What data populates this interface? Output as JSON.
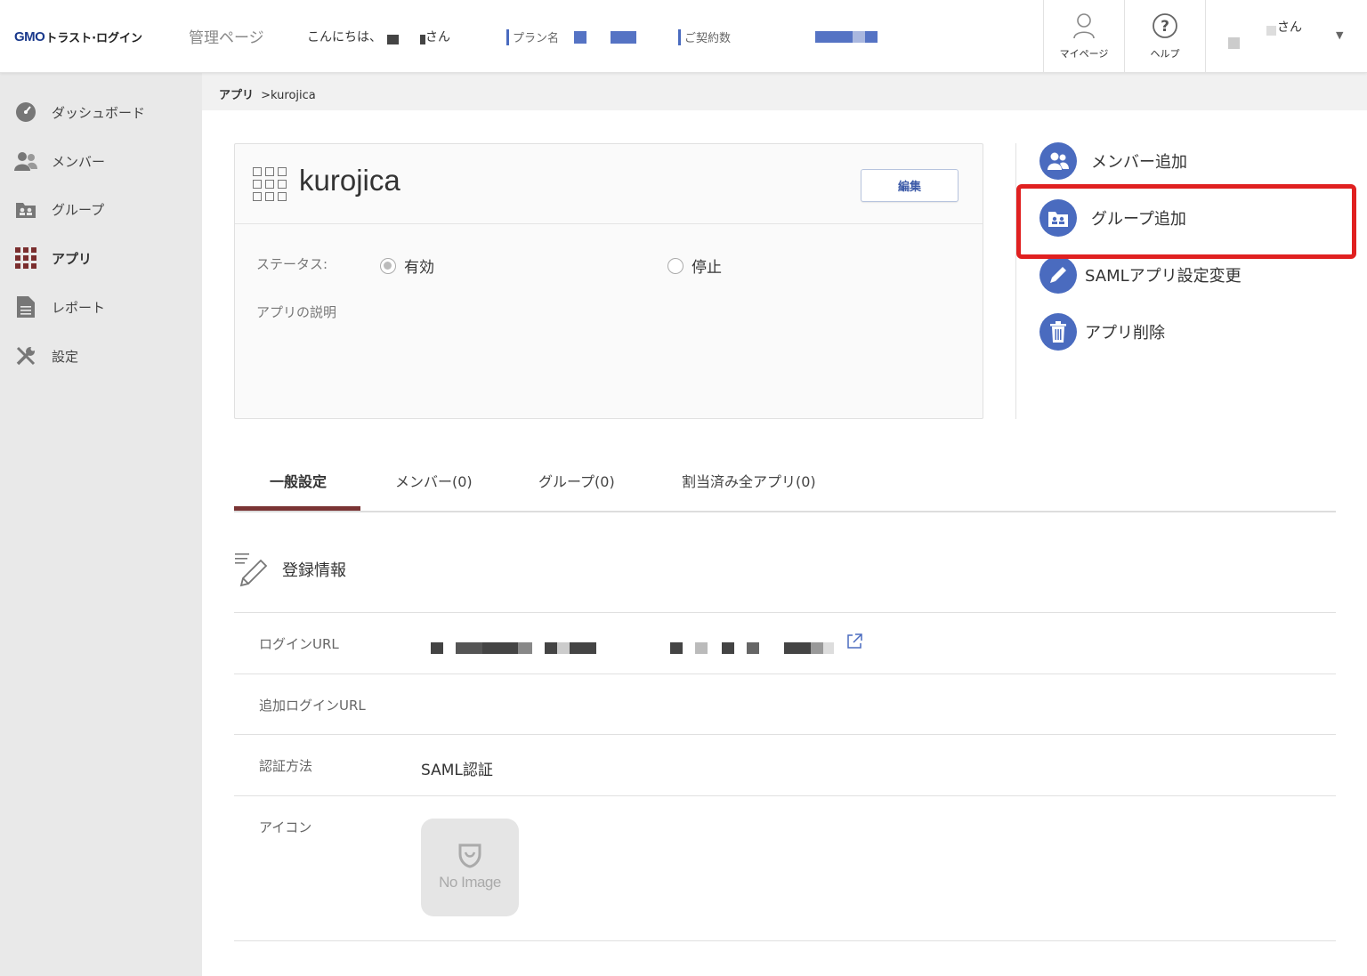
{
  "header": {
    "logo_brand": "GMO",
    "logo_text": "トラスト·ログイン",
    "admin_title": "管理ページ",
    "greeting_prefix": "こんにちは、",
    "greeting_suffix": "さん",
    "plan_label": "プラン名",
    "contract_label": "ご契約数",
    "mypage_label": "マイページ",
    "help_label": "ヘルプ",
    "user_suffix": "さん"
  },
  "sidebar": {
    "items": [
      {
        "label": "ダッシュボード",
        "icon": "dashboard-icon"
      },
      {
        "label": "メンバー",
        "icon": "members-icon"
      },
      {
        "label": "グループ",
        "icon": "group-icon"
      },
      {
        "label": "アプリ",
        "icon": "apps-grid-icon"
      },
      {
        "label": "レポート",
        "icon": "report-icon"
      },
      {
        "label": "設定",
        "icon": "settings-tools-icon"
      }
    ],
    "active_index": 3
  },
  "breadcrumb": {
    "parent": "アプリ",
    "current": ">kurojica"
  },
  "app_card": {
    "name": "kurojica",
    "edit_label": "編集",
    "status_label": "ステータス:",
    "status_enabled": "有効",
    "status_disabled": "停止",
    "status_selected": "有効",
    "description_label": "アプリの説明"
  },
  "actions": [
    {
      "label": "メンバー追加",
      "icon": "add-member-icon"
    },
    {
      "label": "グループ追加",
      "icon": "add-group-icon"
    },
    {
      "label": "SAMLアプリ設定変更",
      "icon": "pencil-icon"
    },
    {
      "label": "アプリ削除",
      "icon": "trash-icon"
    }
  ],
  "tabs": [
    {
      "label": "一般設定",
      "active": true
    },
    {
      "label": "メンバー(0)",
      "active": false
    },
    {
      "label": "グループ(0)",
      "active": false
    },
    {
      "label": "割当済み全アプリ(0)",
      "active": false
    }
  ],
  "registration": {
    "title": "登録情報",
    "login_url_label": "ログインURL",
    "additional_login_url_label": "追加ログインURL",
    "auth_method_label": "認証方法",
    "auth_method_value": "SAML認証",
    "icon_label": "アイコン",
    "no_image_text": "No Image"
  },
  "colors": {
    "accent_blue": "#4a6bbf",
    "tab_active": "#7a3434",
    "highlight_red": "#e02020",
    "sidebar_bg": "#e9e9e9"
  }
}
